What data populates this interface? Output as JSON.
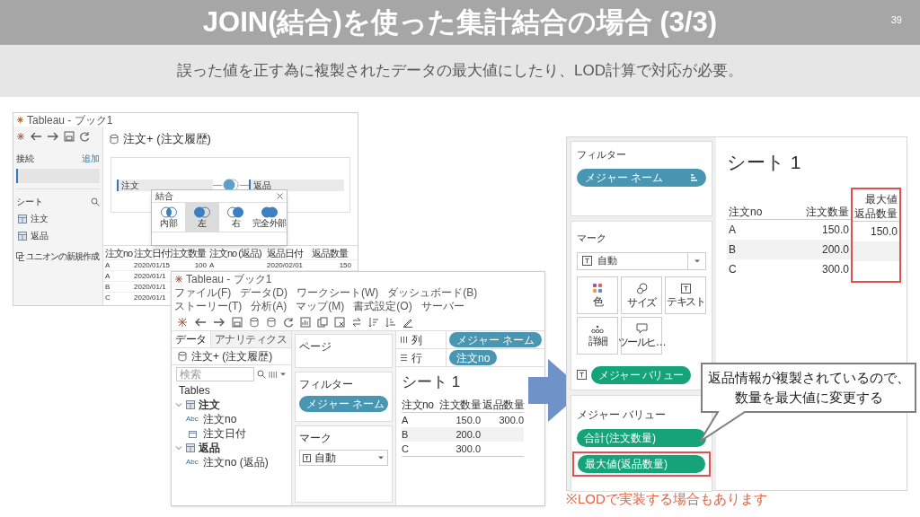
{
  "slide": {
    "title": "JOIN(結合)を使った集計結合の場合 (3/3)",
    "page_number": "39",
    "subtitle": "誤った値を正す為に複製されたデータの最大値にしたり、LOD計算で対応が必要。"
  },
  "screenshot_1": {
    "window_title": "Tableau - ブック1",
    "connections_label": "接続",
    "add_link": "追加",
    "sheets_label": "シート",
    "sheets": [
      "注文",
      "返品"
    ],
    "new_union": "ユニオンの新規作成",
    "heading": "注文+ (注文履歴)",
    "join_tables": [
      "注文",
      "返品"
    ],
    "join_dialog": {
      "title": "結合",
      "types": [
        {
          "label": "内部",
          "kind": "inner",
          "selected": false
        },
        {
          "label": "左",
          "kind": "left",
          "selected": true
        },
        {
          "label": "右",
          "kind": "right",
          "selected": false
        },
        {
          "label": "完全外部",
          "kind": "full",
          "selected": false
        }
      ]
    },
    "table": {
      "columns": [
        "注文no",
        "注文日付",
        "注文数量",
        "注文no (返品)",
        "返品日付",
        "返品数量"
      ],
      "rows": [
        [
          "A",
          "2020/01/15",
          "100",
          "A",
          "2020/02/01",
          "150"
        ],
        [
          "A",
          "2020/01/1"
        ],
        [
          "B",
          "2020/01/1"
        ],
        [
          "C",
          "2020/01/1"
        ]
      ]
    }
  },
  "screenshot_2": {
    "window_title": "Tableau - ブック1",
    "menu": [
      "ファイル(F)",
      "データ(D)",
      "ワークシート(W)",
      "ダッシュボード(B)",
      "ストーリー(T)",
      "分析(A)",
      "マップ(M)",
      "書式設定(O)",
      "サーバー"
    ],
    "data_tabs": [
      {
        "label": "データ",
        "selected": true
      },
      {
        "label": "アナリティクス",
        "selected": false
      }
    ],
    "data_source": "注文+ (注文履歴)",
    "search": {
      "placeholder": "検索"
    },
    "tables_label": "Tables",
    "tables": [
      {
        "name": "注文",
        "expanded": true,
        "children": [
          {
            "name": "注文no",
            "kind": "string",
            "type_label": "Abc"
          },
          {
            "name": "注文日付",
            "kind": "date"
          }
        ]
      },
      {
        "name": "返品",
        "expanded": true,
        "children": [
          {
            "name": "注文no (返品)",
            "kind": "string",
            "type_label": "Abc"
          }
        ]
      }
    ],
    "pages_label": "ページ",
    "filters": {
      "label": "フィルター",
      "pills": [
        "メジャー ネーム"
      ]
    },
    "marks": {
      "label": "マーク",
      "type": "自動"
    },
    "columns_shelf": {
      "label": "列",
      "pills": [
        "メジャー ネーム"
      ]
    },
    "rows_shelf": {
      "label": "行",
      "pills": [
        "注文no"
      ]
    },
    "sheet": {
      "title": "シート 1",
      "columns": [
        "注文no",
        "注文数量",
        "返品数量"
      ],
      "rows": [
        [
          "A",
          "150.0",
          "300.0"
        ],
        [
          "B",
          "200.0"
        ],
        [
          "C",
          "300.0"
        ]
      ]
    }
  },
  "screenshot_3": {
    "filters": {
      "label": "フィルター",
      "pills": [
        "メジャー ネーム"
      ]
    },
    "marks": {
      "label": "マーク",
      "type": "自動",
      "buttons": [
        {
          "label": "色",
          "kind": "color"
        },
        {
          "label": "サイズ",
          "kind": "size"
        },
        {
          "label": "テキスト",
          "kind": "text"
        },
        {
          "label": "詳細",
          "kind": "detail"
        },
        {
          "label": "ツールヒ…",
          "kind": "tooltip"
        }
      ],
      "text_pill": "メジャー バリュー"
    },
    "measure_values": {
      "label": "メジャー バリュー",
      "pills": [
        {
          "label": "合計(注文数量)",
          "highlighted": false
        },
        {
          "label": "最大値(返品数量)",
          "highlighted": true
        }
      ]
    },
    "sheet": {
      "title": "シート 1",
      "columns": [
        {
          "label_lines": [
            "注文no"
          ],
          "highlighted": false
        },
        {
          "label_lines": [
            "注文数量"
          ],
          "highlighted": false
        },
        {
          "label_lines": [
            "最大値",
            "返品数量"
          ],
          "highlighted": true
        }
      ],
      "rows": [
        [
          "A",
          "150.0",
          "150.0"
        ],
        [
          "B",
          "200.0"
        ],
        [
          "C",
          "300.0"
        ]
      ]
    }
  },
  "callout": {
    "lines": [
      "返品情報が複製されているので、",
      "数量を最大値に変更する"
    ]
  },
  "note": "※LODで実装する場合もあります"
}
